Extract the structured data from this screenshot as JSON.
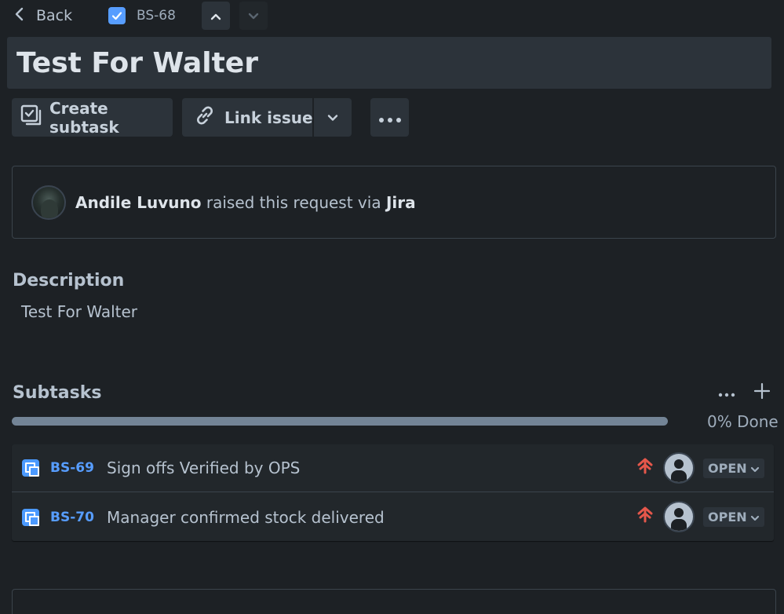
{
  "nav": {
    "back_label": "Back",
    "issue_key": "BS-68",
    "icons": [
      "chevron-left-icon",
      "checkbox-icon",
      "chevron-up-icon",
      "chevron-down-icon"
    ]
  },
  "issue": {
    "title": "Test For Walter"
  },
  "toolbar": {
    "create_subtask_label": "Create subtask",
    "link_issue_label": "Link issue",
    "icons": [
      "subtask-icon",
      "link-icon",
      "chevron-down-icon",
      "more-icon"
    ]
  },
  "request": {
    "reporter": "Andile Luvuno",
    "middle_text": " raised this request via ",
    "channel": "Jira"
  },
  "description": {
    "heading": "Description",
    "body": "Test For Walter"
  },
  "subtasks": {
    "heading": "Subtasks",
    "progress_fraction": 0,
    "done_label": "0% Done",
    "items": [
      {
        "key": "BS-69",
        "summary": "Sign offs Verified by OPS",
        "status": "OPEN",
        "priority_icon": "priority-highest-icon"
      },
      {
        "key": "BS-70",
        "summary": "Manager confirmed stock delivered",
        "status": "OPEN",
        "priority_icon": "priority-highest-icon"
      }
    ]
  },
  "colors": {
    "background": "#1d2125",
    "surface": "#2c333a",
    "link": "#579dff",
    "priority": "#e5574b",
    "progress_track": "#738496"
  }
}
